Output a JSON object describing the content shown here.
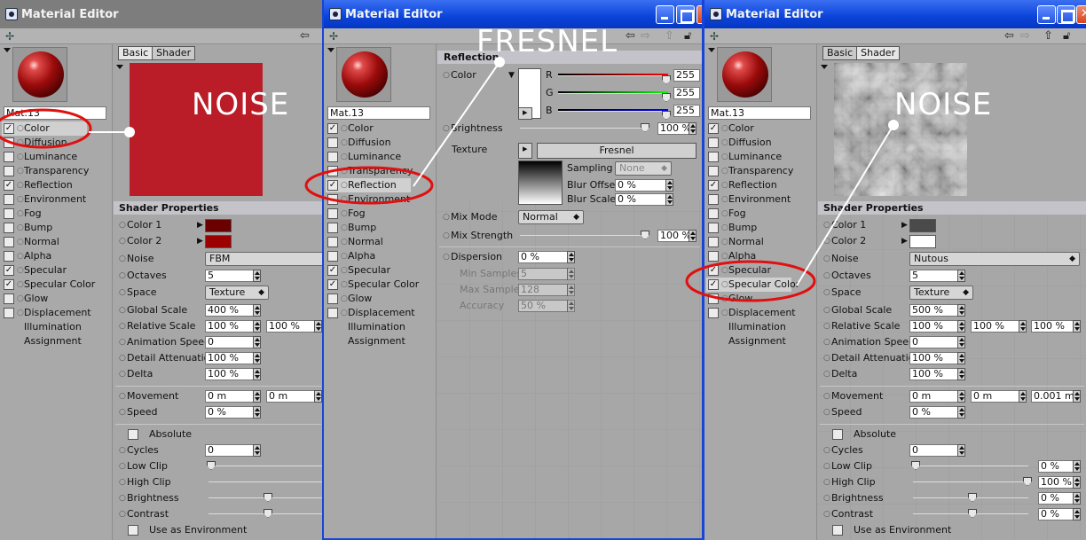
{
  "window_title": "Material Editor",
  "material_name": "Mat.13",
  "channels": [
    "Color",
    "Diffusion",
    "Luminance",
    "Transparency",
    "Reflection",
    "Environment",
    "Fog",
    "Bump",
    "Normal",
    "Alpha",
    "Specular",
    "Specular Color",
    "Glow",
    "Displacement"
  ],
  "extra_items": [
    "Illumination",
    "Assignment"
  ],
  "tabs": {
    "basic": "Basic",
    "shader": "Shader"
  },
  "overlays": {
    "noise": "NOISE",
    "fresnel": "FRESNEL"
  },
  "colors": {
    "title_active": "#0a43d8",
    "annotation": "#e01010",
    "dark_red": "#8b0000",
    "panel_bg": "#a7a7a7"
  },
  "w1": {
    "section": "Shader Properties",
    "color1_label": "Color 1",
    "color2_label": "Color 2",
    "noise_label": "Noise",
    "noise_value": "FBM",
    "octaves_label": "Octaves",
    "octaves_value": "5",
    "space_label": "Space",
    "space_value": "Texture",
    "global_scale_label": "Global Scale",
    "global_scale_value": "400 %",
    "relative_scale_label": "Relative Scale",
    "relative_scale_1": "100 %",
    "relative_scale_2": "100 %",
    "anim_speed_label": "Animation Speed",
    "anim_speed_value": "0",
    "detail_att_label": "Detail Attenuation",
    "detail_att_value": "100 %",
    "delta_label": "Delta",
    "delta_value": "100 %",
    "movement_label": "Movement",
    "movement_1": "0 m",
    "movement_2": "0 m",
    "speed_label": "Speed",
    "speed_value": "0 %",
    "absolute_label": "Absolute",
    "cycles_label": "Cycles",
    "cycles_value": "0",
    "low_clip_label": "Low Clip",
    "high_clip_label": "High Clip",
    "brightness_label": "Brightness",
    "contrast_label": "Contrast",
    "use_env_label": "Use as Environment"
  },
  "w2": {
    "section": "Reflection",
    "color_label": "Color",
    "r_label": "R",
    "g_label": "G",
    "b_label": "B",
    "r_value": "255",
    "g_value": "255",
    "b_value": "255",
    "brightness_label": "Brightness",
    "brightness_value": "100 %",
    "texture_label": "Texture",
    "texture_value": "Fresnel",
    "sampling_label": "Sampling",
    "sampling_value": "None",
    "blur_offset_label": "Blur Offset",
    "blur_offset_value": "0 %",
    "blur_scale_label": "Blur Scale",
    "blur_scale_value": "0 %",
    "mix_mode_label": "Mix Mode",
    "mix_mode_value": "Normal",
    "mix_strength_label": "Mix Strength",
    "mix_strength_value": "100 %",
    "dispersion_label": "Dispersion",
    "dispersion_value": "0 %",
    "min_samples_label": "Min Samples",
    "min_samples_value": "5",
    "max_samples_label": "Max Samples",
    "max_samples_value": "128",
    "accuracy_label": "Accuracy",
    "accuracy_value": "50 %"
  },
  "w3": {
    "section": "Shader Properties",
    "color1_label": "Color 1",
    "color2_label": "Color 2",
    "noise_label": "Noise",
    "noise_value": "Nutous",
    "octaves_label": "Octaves",
    "octaves_value": "5",
    "space_label": "Space",
    "space_value": "Texture",
    "global_scale_label": "Global Scale",
    "global_scale_value": "500 %",
    "relative_scale_label": "Relative Scale",
    "relative_scale_1": "100 %",
    "relative_scale_2": "100 %",
    "relative_scale_3": "100 %",
    "anim_speed_label": "Animation Speed",
    "anim_speed_value": "0",
    "detail_att_label": "Detail Attenuation",
    "detail_att_value": "100 %",
    "delta_label": "Delta",
    "delta_value": "100 %",
    "movement_label": "Movement",
    "movement_1": "0 m",
    "movement_2": "0 m",
    "movement_3": "0.001 m",
    "speed_label": "Speed",
    "speed_value": "0 %",
    "absolute_label": "Absolute",
    "cycles_label": "Cycles",
    "cycles_value": "0",
    "low_clip_label": "Low Clip",
    "low_clip_value": "0 %",
    "high_clip_label": "High Clip",
    "high_clip_value": "100 %",
    "brightness_label": "Brightness",
    "brightness_value": "0 %",
    "contrast_label": "Contrast",
    "contrast_value": "0 %",
    "use_env_label": "Use as Environment"
  }
}
